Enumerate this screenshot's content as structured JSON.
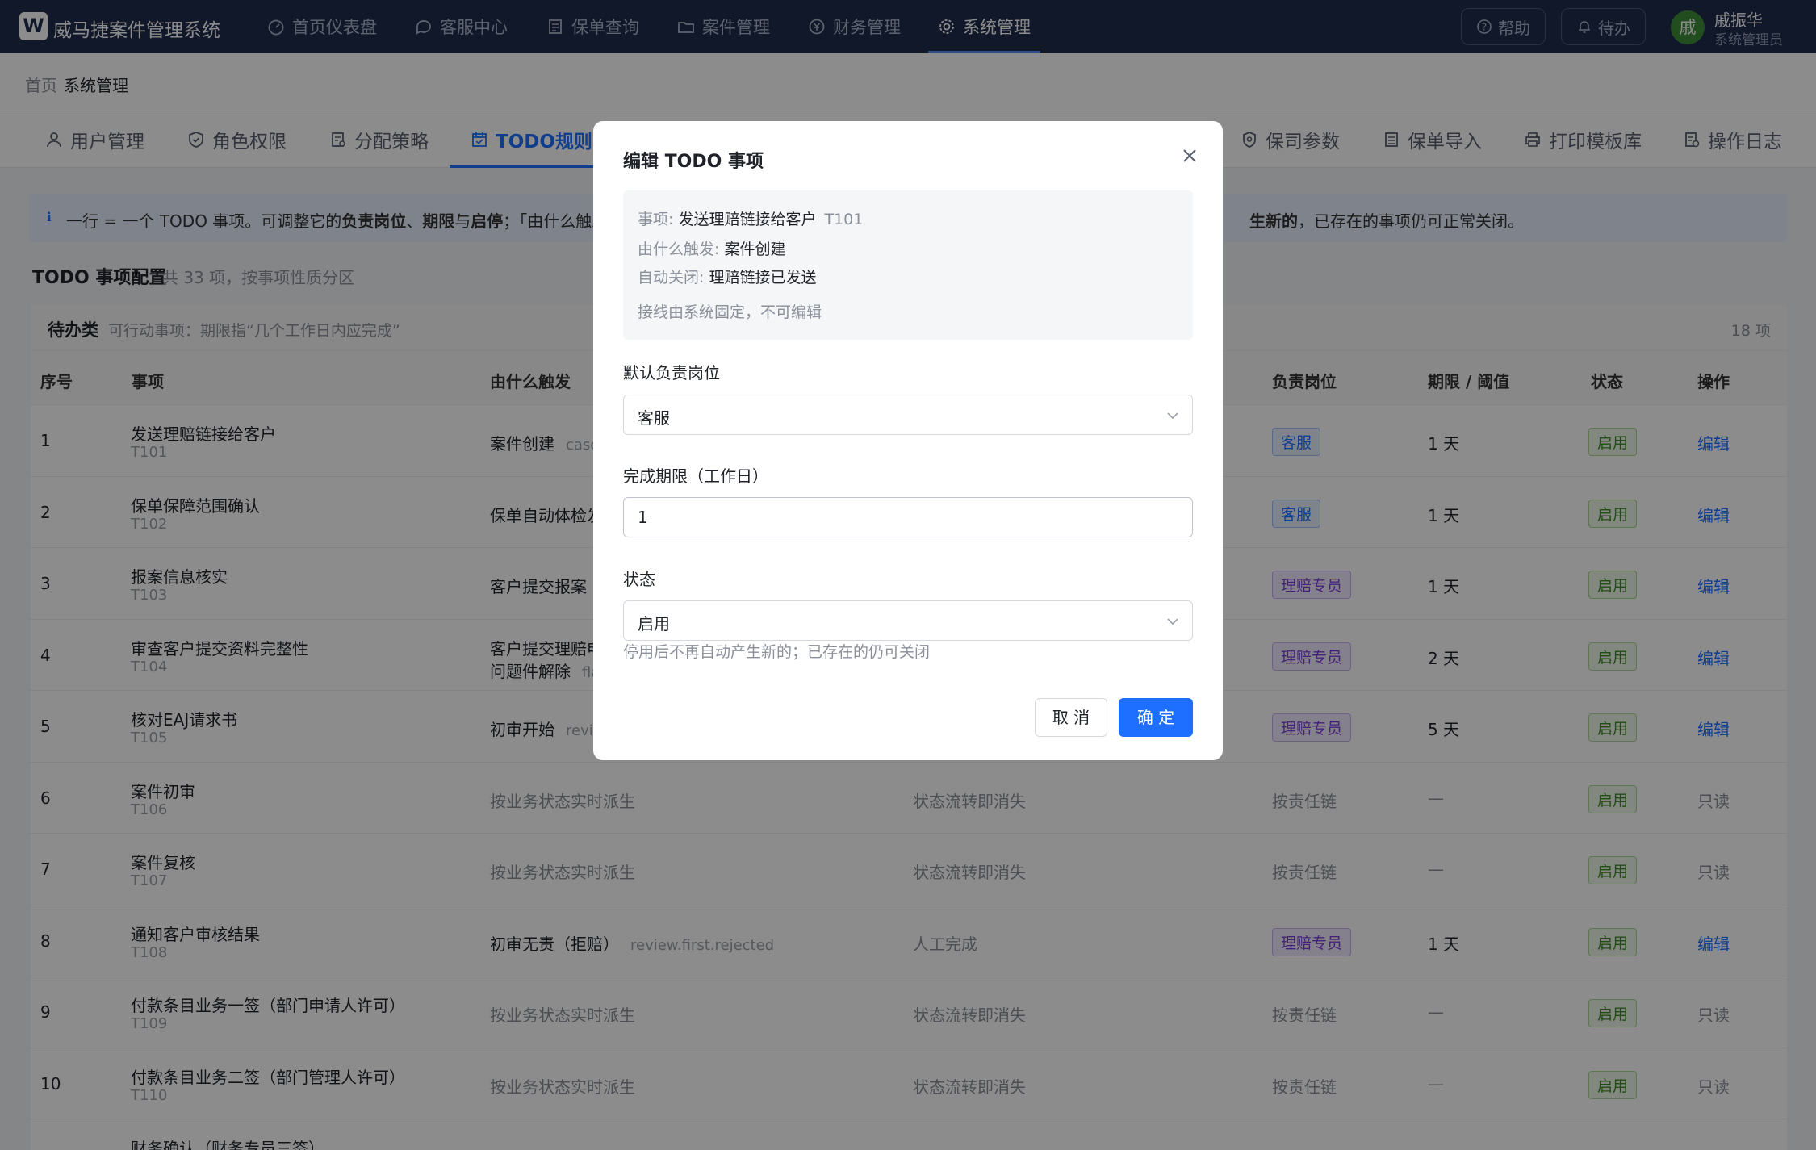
{
  "app": {
    "logo_letter": "W",
    "name": "威马捷案件管理系统"
  },
  "nav": [
    {
      "label": "首页仪表盘",
      "icon": "dashboard-icon"
    },
    {
      "label": "客服中心",
      "icon": "chat-icon"
    },
    {
      "label": "保单查询",
      "icon": "document-icon"
    },
    {
      "label": "案件管理",
      "icon": "folder-icon"
    },
    {
      "label": "财务管理",
      "icon": "yen-icon"
    },
    {
      "label": "系统管理",
      "icon": "gear-icon",
      "active": true
    }
  ],
  "top_actions": {
    "help": "帮助",
    "todo": "待办"
  },
  "user": {
    "avatar": "戚",
    "name": "戚振华",
    "role": "系统管理员"
  },
  "breadcrumb": {
    "home": "首页",
    "current": "系统管理"
  },
  "subtabs": [
    {
      "label": "用户管理",
      "icon": "user-icon"
    },
    {
      "label": "角色权限",
      "icon": "shield-icon"
    },
    {
      "label": "分配策略",
      "icon": "strategy-icon"
    },
    {
      "label": "TODO规则",
      "icon": "calendar-icon",
      "active": true
    },
    {
      "label": "保司参数",
      "icon": "badge-icon"
    },
    {
      "label": "保单导入",
      "icon": "list-icon"
    },
    {
      "label": "打印模板库",
      "icon": "printer-icon"
    },
    {
      "label": "操作日志",
      "icon": "log-icon"
    }
  ],
  "info_banner": {
    "icon": "i",
    "left_1": "一行 = 一个 TODO 事项。可调整它的",
    "left_b1": "负责岗位",
    "left_2": "、",
    "left_b2": "期限",
    "left_3": "与",
    "left_b3": "启停",
    "left_4": "；「由什么触发",
    "right_b": "生新的",
    "right_1": "，已存在的事项仍可正常关闭。"
  },
  "section": {
    "title": "TODO 事项配置",
    "subtitle": "共 33 项，按事项性质分区"
  },
  "group": {
    "title": "待办类",
    "subtitle": "可行动事项：期限指“几个工作日内应完成”",
    "count": "18 项"
  },
  "columns": {
    "no": "序号",
    "item": "事项",
    "trigger": "由什么触发",
    "role": "负责岗位",
    "deadline": "期限 / 阈值",
    "status": "状态",
    "action": "操作"
  },
  "rows": [
    {
      "no": "1",
      "name": "发送理赔链接给客户",
      "code": "T101",
      "trigger": "案件创建",
      "trigger_code": "case",
      "close": "",
      "role": "客服",
      "role_type": "kf",
      "deadline": "1 天",
      "status": "启用",
      "action": "编辑",
      "editable": true
    },
    {
      "no": "2",
      "name": "保单保障范围确认",
      "code": "T102",
      "trigger": "保单自动体检发",
      "trigger_code": "",
      "close": "",
      "role": "客服",
      "role_type": "kf",
      "deadline": "1 天",
      "status": "启用",
      "action": "编辑",
      "editable": true
    },
    {
      "no": "3",
      "name": "报案信息核实",
      "code": "T103",
      "trigger": "客户提交报案",
      "trigger_code": "",
      "close": "",
      "role": "理赔专员",
      "role_type": "lp",
      "deadline": "1 天",
      "status": "启用",
      "action": "编辑",
      "editable": true
    },
    {
      "no": "4",
      "name": "审查客户提交资料完整性",
      "code": "T104",
      "trigger": "客户提交理赔申",
      "trigger2": "问题件解除",
      "trigger_code2": "fla",
      "close": "",
      "role": "理赔专员",
      "role_type": "lp",
      "deadline": "2 天",
      "status": "启用",
      "action": "编辑",
      "editable": true
    },
    {
      "no": "5",
      "name": "核对EAJ请求书",
      "code": "T105",
      "trigger": "初审开始",
      "trigger_code": "revie",
      "close": "",
      "role": "理赔专员",
      "role_type": "lp",
      "deadline": "5 天",
      "status": "启用",
      "action": "编辑",
      "editable": true
    },
    {
      "no": "6",
      "name": "案件初审",
      "code": "T106",
      "trigger": "按业务状态实时派生",
      "trigger_code": "",
      "close": "状态流转即消失",
      "role": "按责任链",
      "role_type": "text",
      "deadline": "—",
      "status": "启用",
      "action": "只读",
      "editable": false
    },
    {
      "no": "7",
      "name": "案件复核",
      "code": "T107",
      "trigger": "按业务状态实时派生",
      "trigger_code": "",
      "close": "状态流转即消失",
      "role": "按责任链",
      "role_type": "text",
      "deadline": "—",
      "status": "启用",
      "action": "只读",
      "editable": false
    },
    {
      "no": "8",
      "name": "通知客户审核结果",
      "code": "T108",
      "trigger": "初审无责（拒赔）",
      "trigger_code": "review.first.rejected",
      "close": "人工完成",
      "role": "理赔专员",
      "role_type": "lp",
      "deadline": "1 天",
      "status": "启用",
      "action": "编辑",
      "editable": true
    },
    {
      "no": "9",
      "name": "付款条目业务一签（部门申请人许可）",
      "code": "T109",
      "trigger": "按业务状态实时派生",
      "trigger_code": "",
      "close": "状态流转即消失",
      "role": "按责任链",
      "role_type": "text",
      "deadline": "—",
      "status": "启用",
      "action": "只读",
      "editable": false
    },
    {
      "no": "10",
      "name": "付款条目业务二签（部门管理人许可）",
      "code": "T110",
      "trigger": "按业务状态实时派生",
      "trigger_code": "",
      "close": "状态流转即消失",
      "role": "按责任链",
      "role_type": "text",
      "deadline": "—",
      "status": "启用",
      "action": "只读",
      "editable": false
    },
    {
      "no": "",
      "name": "财务确认（财务专员三签）",
      "code": "",
      "trigger": "",
      "trigger_code": "",
      "close": "",
      "role": "",
      "role_type": "none",
      "deadline": "",
      "status": "",
      "action": "",
      "editable": false
    }
  ],
  "modal": {
    "title": "编辑 TODO 事项",
    "item_key": "事项:",
    "item_val": "发送理赔链接给客户",
    "item_code": "T101",
    "trigger_key": "由什么触发:",
    "trigger_val": "案件创建",
    "close_key": "自动关闭:",
    "close_val": "理赔链接已发送",
    "note": "接线由系统固定，不可编辑",
    "role_label": "默认负责岗位",
    "role_value": "客服",
    "deadline_label": "完成期限（工作日）",
    "deadline_value": "1",
    "status_label": "状态",
    "status_value": "启用",
    "status_hint": "停用后不再自动产生新的；已存在的仍可关闭",
    "cancel": "取 消",
    "ok": "确 定"
  },
  "colors": {
    "topnav": "#1f2d4e",
    "primary": "#1e6fff",
    "banner": "#e7f0ff",
    "tag_kf": "#1e6fff",
    "tag_lp": "#7a3fd8",
    "tag_on": "#3d8b23"
  }
}
